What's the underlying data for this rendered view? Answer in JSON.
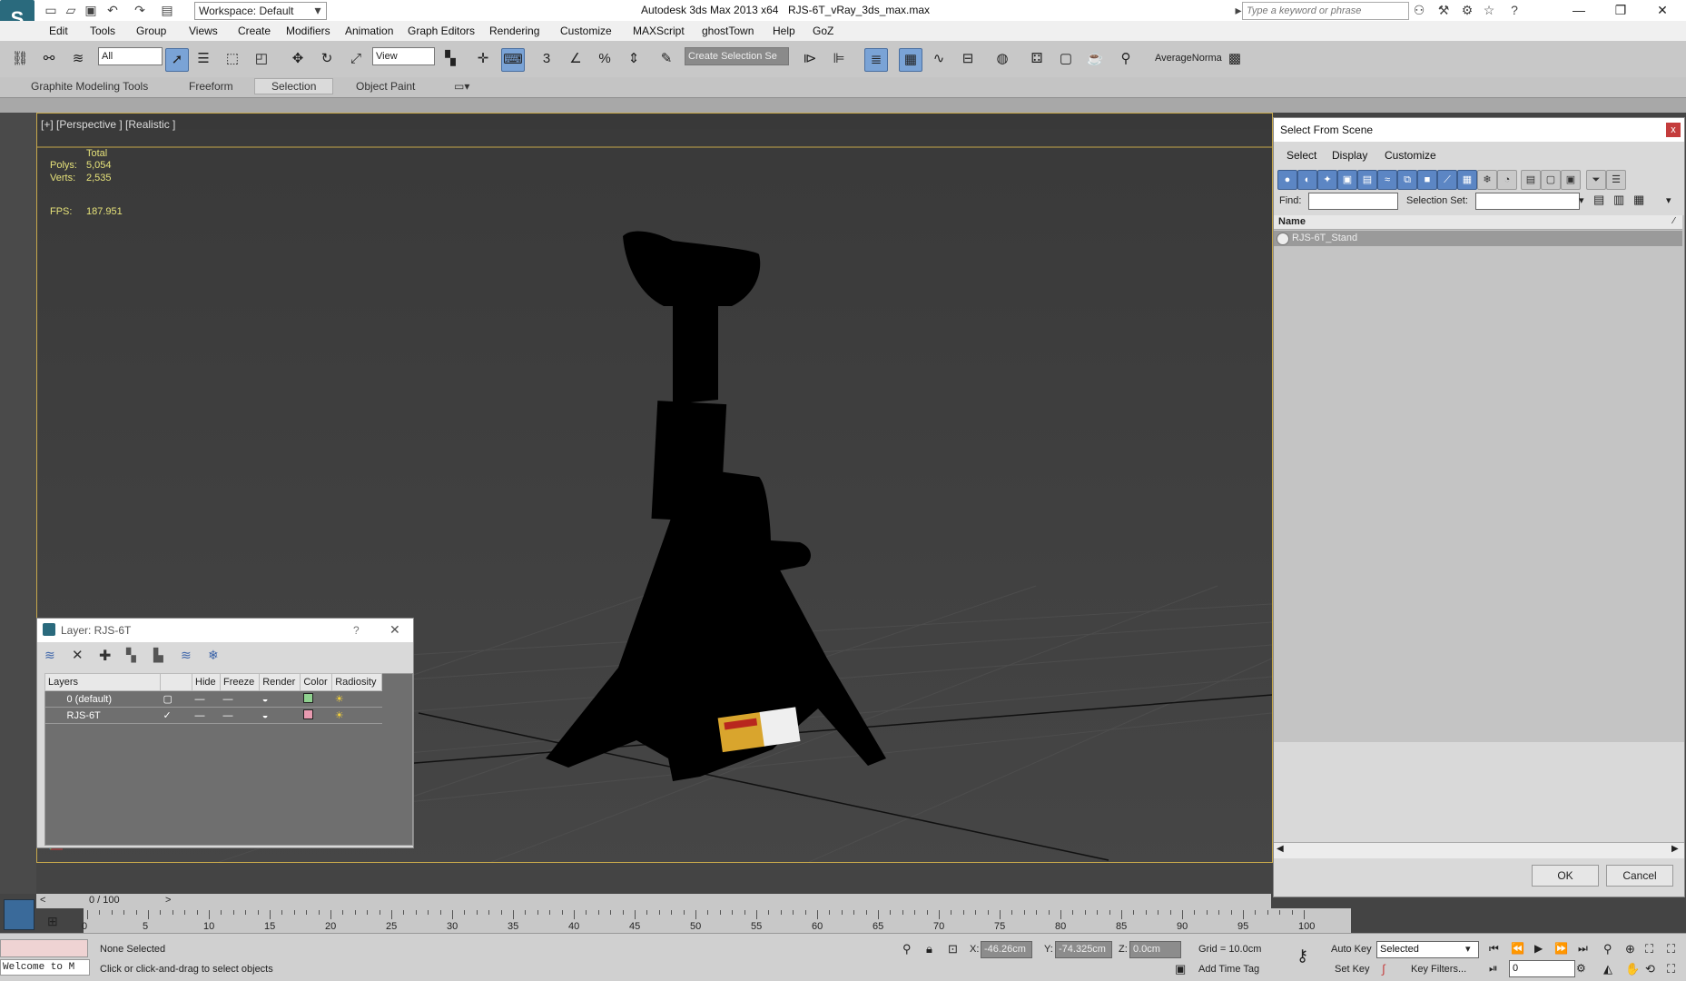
{
  "titlebar": {
    "workspace": "Workspace: Default",
    "title": "Autodesk 3ds Max  2013 x64",
    "file": "RJS-6T_vRay_3ds_max.max",
    "search_placeholder": "Type a keyword or phrase"
  },
  "menu": [
    "Edit",
    "Tools",
    "Group",
    "Views",
    "Create",
    "Modifiers",
    "Animation",
    "Graph Editors",
    "Rendering",
    "Customize",
    "MAXScript",
    "ghostTown",
    "Help",
    "GoZ"
  ],
  "toolbar": {
    "filter": "All",
    "ref_coord": "View",
    "selection_set": "Create Selection Se",
    "normals_label": "AverageNorma"
  },
  "ribbon": {
    "tabs": [
      "Graphite Modeling Tools",
      "Freeform",
      "Selection",
      "Object Paint"
    ],
    "active": "Selection"
  },
  "viewport": {
    "label": "[+] [Perspective ] [Realistic ]",
    "stats": {
      "total_label": "Total",
      "polys_label": "Polys:",
      "polys": "5,054",
      "verts_label": "Verts:",
      "verts": "2,535",
      "fps_label": "FPS:",
      "fps": "187.951"
    }
  },
  "select_from_scene": {
    "title": "Select From Scene",
    "menu": [
      "Select",
      "Display",
      "Customize"
    ],
    "find_label": "Find:",
    "selection_set_label": "Selection Set:",
    "column": "Name",
    "items": [
      "RJS-6T_Stand"
    ],
    "ok": "OK",
    "cancel": "Cancel"
  },
  "layer_dialog": {
    "title": "Layer: RJS-6T",
    "help": "?",
    "columns": [
      "Layers",
      "Hide",
      "Freeze",
      "Render",
      "Color",
      "Radiosity"
    ],
    "rows": [
      {
        "name": "0 (default)",
        "color": "#8fd18f"
      },
      {
        "name": "RJS-6T",
        "color": "#e89ab0"
      }
    ]
  },
  "timeline": {
    "frame": "0 / 100",
    "ticks": [
      "0",
      "5",
      "10",
      "15",
      "20",
      "25",
      "30",
      "35",
      "40",
      "45",
      "50",
      "55",
      "60",
      "65",
      "70",
      "75",
      "80",
      "85",
      "90",
      "95",
      "100"
    ]
  },
  "status": {
    "selection": "None Selected",
    "prompt": "Click or click-and-drag to select objects",
    "welcome": "Welcome to M",
    "x_label": "X:",
    "x": "-46.26cm",
    "y_label": "Y:",
    "y": "-74.325cm",
    "z_label": "Z:",
    "z": "0.0cm",
    "grid": "Grid = 10.0cm",
    "add_time_tag": "Add Time Tag",
    "auto_key": "Auto Key",
    "set_key": "Set Key",
    "key_mode": "Selected",
    "key_filters": "Key Filters...",
    "current_frame": "0"
  }
}
